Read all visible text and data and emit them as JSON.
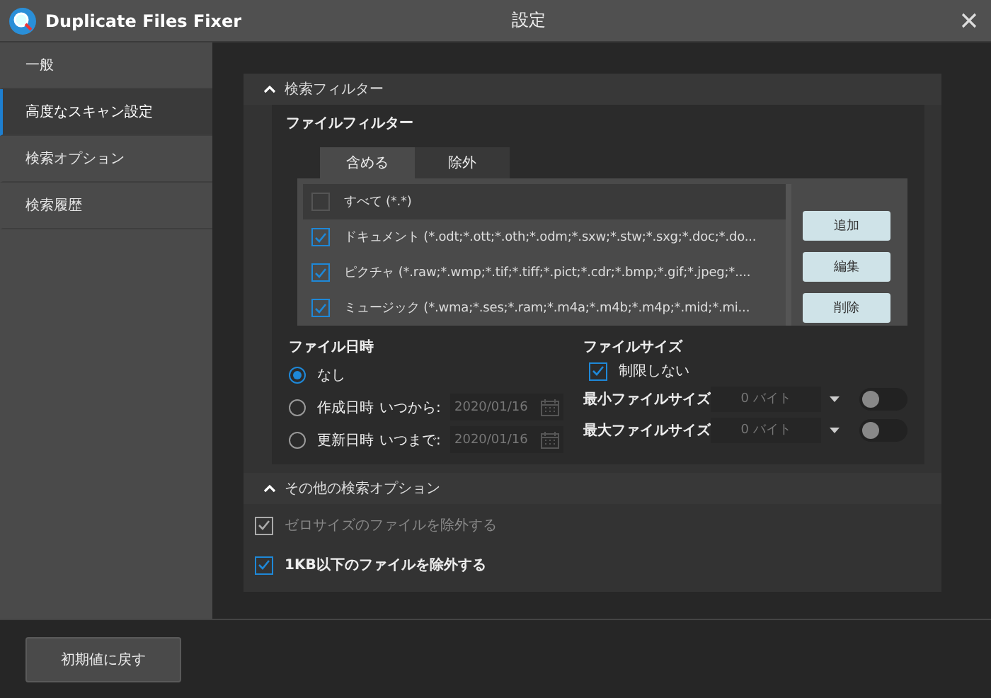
{
  "window": {
    "app_name": "Duplicate Files Fixer",
    "title": "設定"
  },
  "sidebar": {
    "items": [
      {
        "label": "一般",
        "selected": false
      },
      {
        "label": "高度なスキャン設定",
        "selected": true
      },
      {
        "label": "検索オプション",
        "selected": false
      },
      {
        "label": "検索履歴",
        "selected": false
      }
    ]
  },
  "search_filter": {
    "title": "検索フィルター",
    "expanded": true,
    "file_filter": {
      "title": "ファイルフィルター",
      "tabs": [
        {
          "label": "含める",
          "selected": true
        },
        {
          "label": "除外",
          "selected": false
        }
      ],
      "items": [
        {
          "label": "すべて (*.*)",
          "checked": false,
          "selected": true
        },
        {
          "label": "ドキュメント (*.odt;*.ott;*.oth;*.odm;*.sxw;*.stw;*.sxg;*.doc;*.do...",
          "checked": true,
          "selected": false
        },
        {
          "label": "ピクチャ (*.raw;*.wmp;*.tif;*.tiff;*.pict;*.cdr;*.bmp;*.gif;*.jpeg;*....",
          "checked": true,
          "selected": false
        },
        {
          "label": "ミュージック (*.wma;*.ses;*.ram;*.m4a;*.m4b;*.m4p;*.mid;*.mi...",
          "checked": true,
          "selected": false
        }
      ],
      "buttons": [
        "追加",
        "編集",
        "削除"
      ]
    },
    "file_date": {
      "title": "ファイル日時",
      "options": [
        {
          "label": "なし",
          "selected": true
        },
        {
          "label": "作成日時",
          "selected": false
        },
        {
          "label": "更新日時",
          "selected": false
        }
      ],
      "from": {
        "label": "いつから:",
        "value": "2020/01/16"
      },
      "to": {
        "label": "いつまで:",
        "value": "2020/01/16"
      }
    },
    "file_size": {
      "title": "ファイルサイズ",
      "no_limit": {
        "label": "制限しない",
        "checked": true
      },
      "limits": [
        {
          "label": "最小ファイルサイズ",
          "value": "0 バイト",
          "on": false
        },
        {
          "label": "最大ファイルサイズ",
          "value": "0 バイト",
          "on": false
        }
      ]
    }
  },
  "other_options": {
    "title": "その他の検索オプション",
    "expanded": true,
    "items": [
      {
        "label": "ゼロサイズのファイルを除外する",
        "checked": true,
        "disabled": true
      },
      {
        "label": "1KB以下のファイルを除外する",
        "checked": true,
        "disabled": false
      }
    ]
  },
  "footer": {
    "reset_button": "初期値に戻す"
  }
}
